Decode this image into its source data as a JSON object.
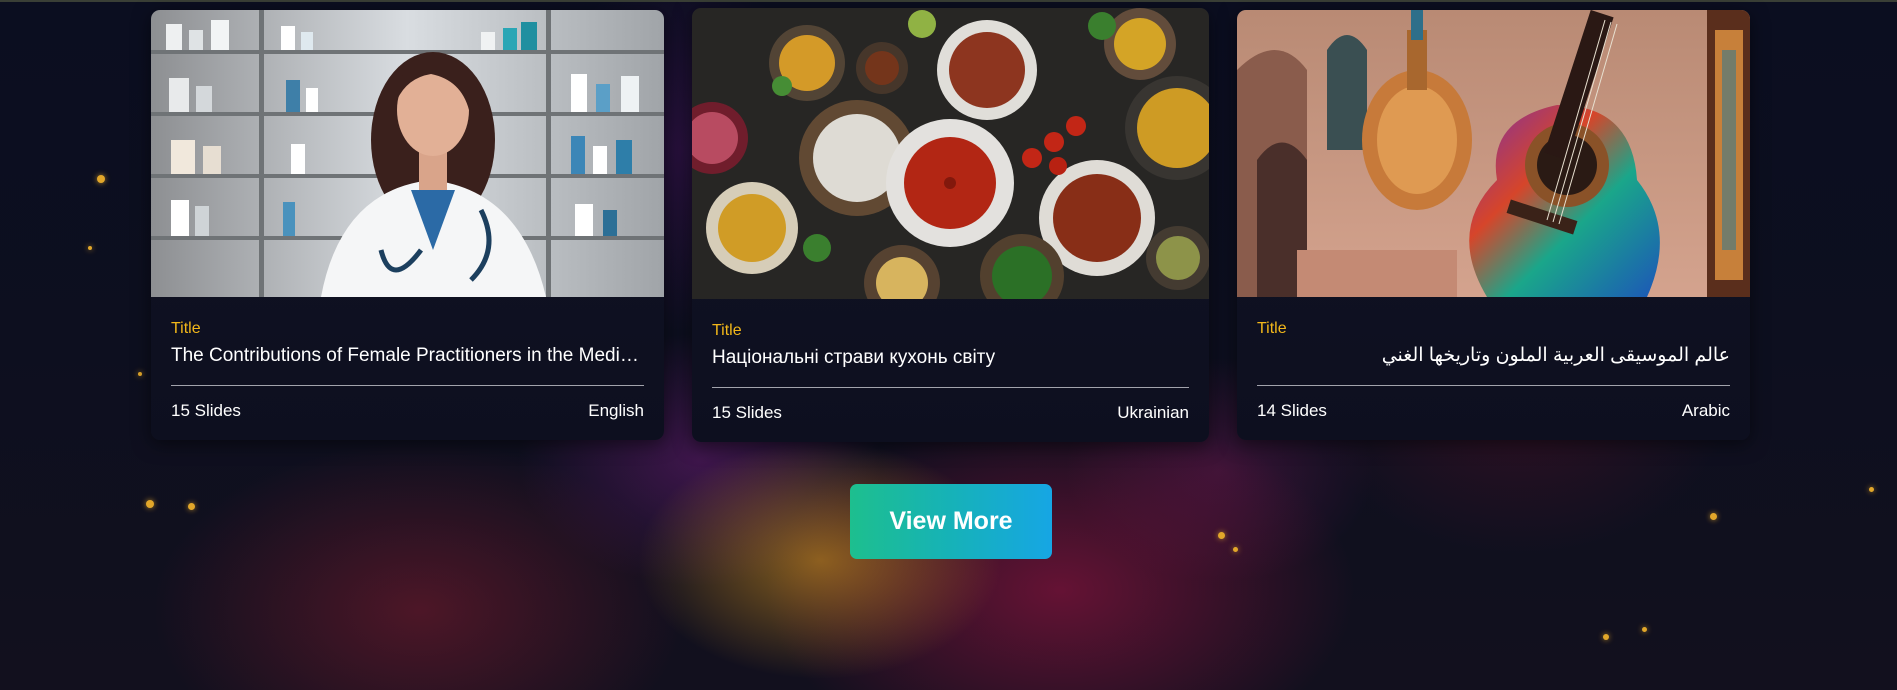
{
  "cards": [
    {
      "label": "Title",
      "title": "The Contributions of Female Practitioners in the Medical Field",
      "slides": "15 Slides",
      "language": "English"
    },
    {
      "label": "Title",
      "title": "Національні страви кухонь світу",
      "slides": "15 Slides",
      "language": "Ukrainian"
    },
    {
      "label": "Title",
      "title": "عالم الموسيقى العربية الملون وتاريخها الغني",
      "slides": "14 Slides",
      "language": "Arabic"
    }
  ],
  "view_more": {
    "label": "View More"
  },
  "colors": {
    "accent_label": "#f2b71a",
    "button_start": "#1dbf8e",
    "button_end": "#16a6e4",
    "background": "#0b0d1c"
  }
}
